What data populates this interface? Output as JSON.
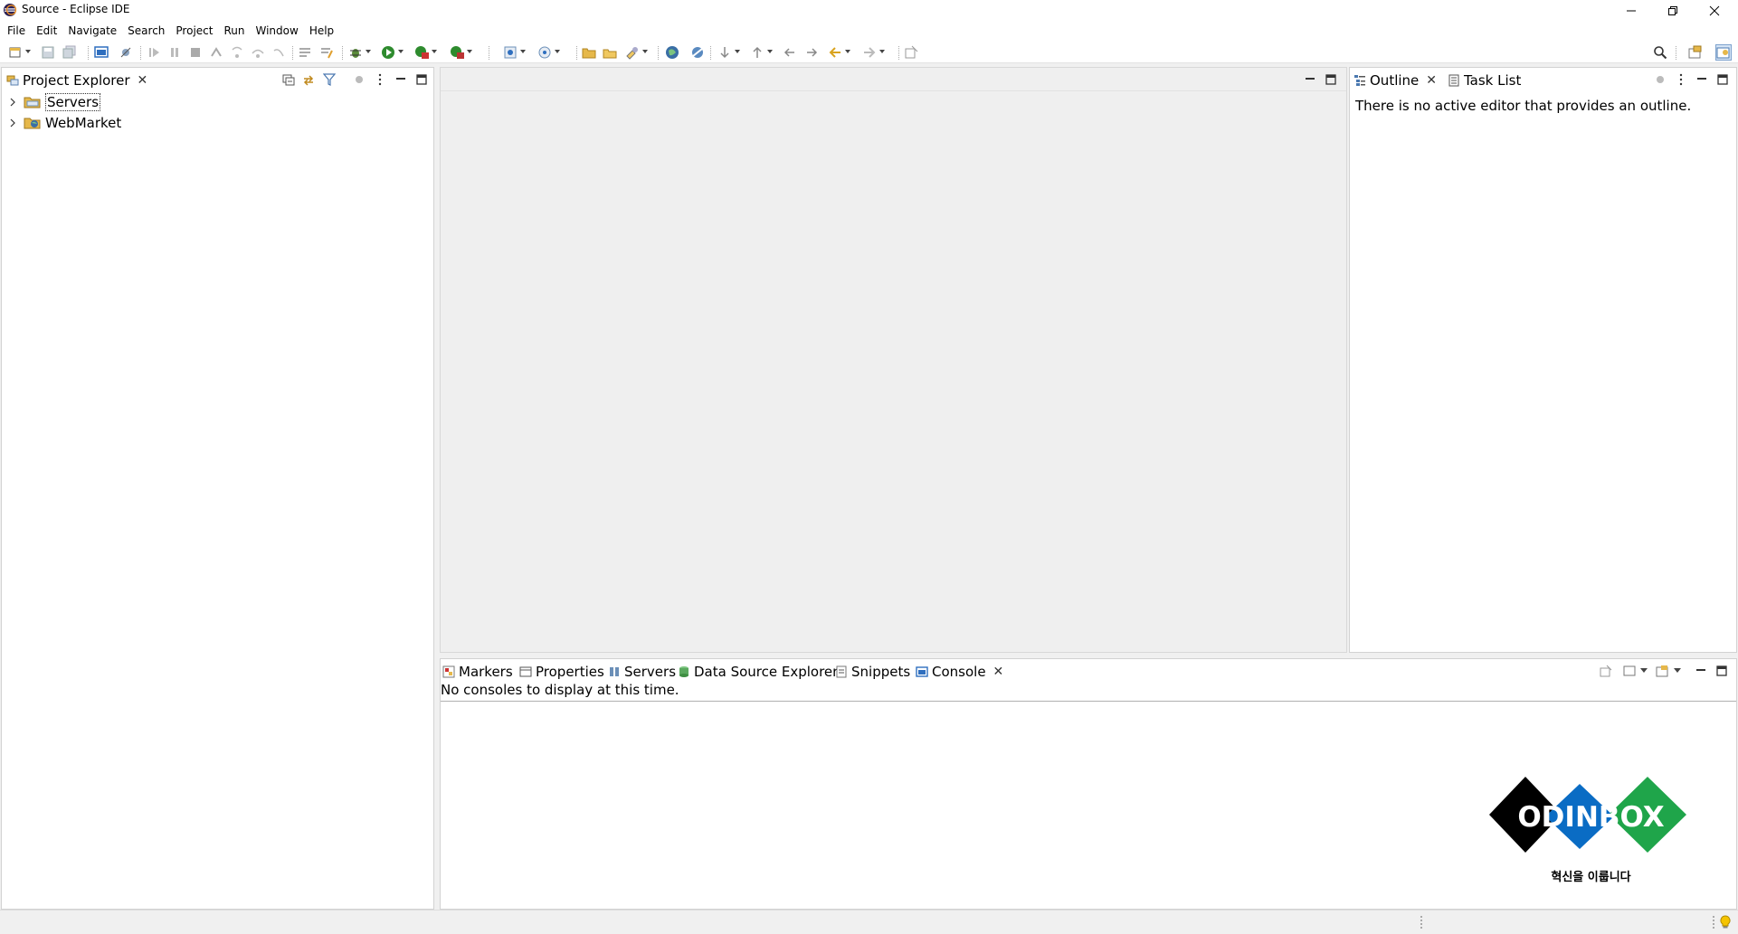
{
  "window": {
    "title": "Source - Eclipse IDE"
  },
  "menu": [
    "File",
    "Edit",
    "Navigate",
    "Search",
    "Project",
    "Run",
    "Window",
    "Help"
  ],
  "project_explorer": {
    "tab_label": "Project Explorer",
    "items": [
      {
        "label": "Servers"
      },
      {
        "label": "WebMarket"
      }
    ]
  },
  "outline": {
    "tabs": [
      "Outline",
      "Task List"
    ],
    "message": "There is no active editor that provides an outline."
  },
  "bottom": {
    "tabs": [
      "Markers",
      "Properties",
      "Servers",
      "Data Source Explorer",
      "Snippets",
      "Console"
    ],
    "message": "No consoles to display at this time."
  },
  "watermark": {
    "brand": "ODINBOX",
    "slogan": "혁신을 이룹니다"
  },
  "colors": {
    "accent": "#2f6fbf",
    "panel_border": "#d2d2d2",
    "brand_black": "#000000",
    "brand_blue": "#0a6cc4",
    "brand_green": "#1fa54a"
  }
}
